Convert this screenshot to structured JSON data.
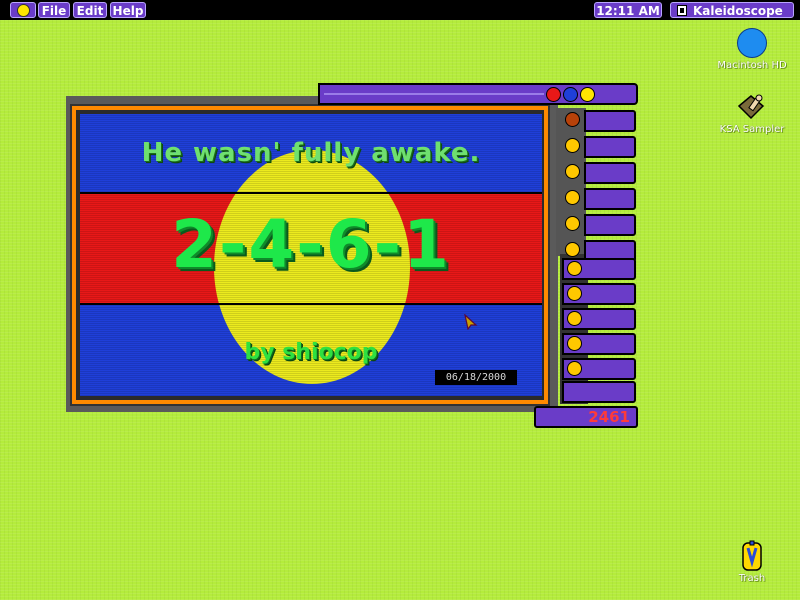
{
  "menubar": {
    "menus": [
      "File",
      "Edit",
      "Help"
    ],
    "clock": "12:11 AM",
    "app_name": "Kaleidoscope"
  },
  "desktop": {
    "icons": [
      {
        "label": "Macintosh HD",
        "icon": "hard-disk-icon"
      },
      {
        "label": "KSA Sampler",
        "icon": "ksa-sampler-icon"
      },
      {
        "label": "Trash",
        "icon": "trash-icon"
      }
    ]
  },
  "window": {
    "headline": "He wasn' fully awake.",
    "title": "2-4-6-1",
    "byline": "by shiocop",
    "date": "06/18/2000",
    "badge": "2461"
  },
  "colors": {
    "desktop": "#b4ec3c",
    "accent": "#6a3cc8",
    "frame": "#ff8a00",
    "band_blue": "#1f3fd8",
    "band_red": "#e81818",
    "sun": "#ecea1e",
    "text_green": "#1ee84a",
    "control_dots": [
      "#e81818",
      "#1f3fd8",
      "#ffe600"
    ]
  }
}
